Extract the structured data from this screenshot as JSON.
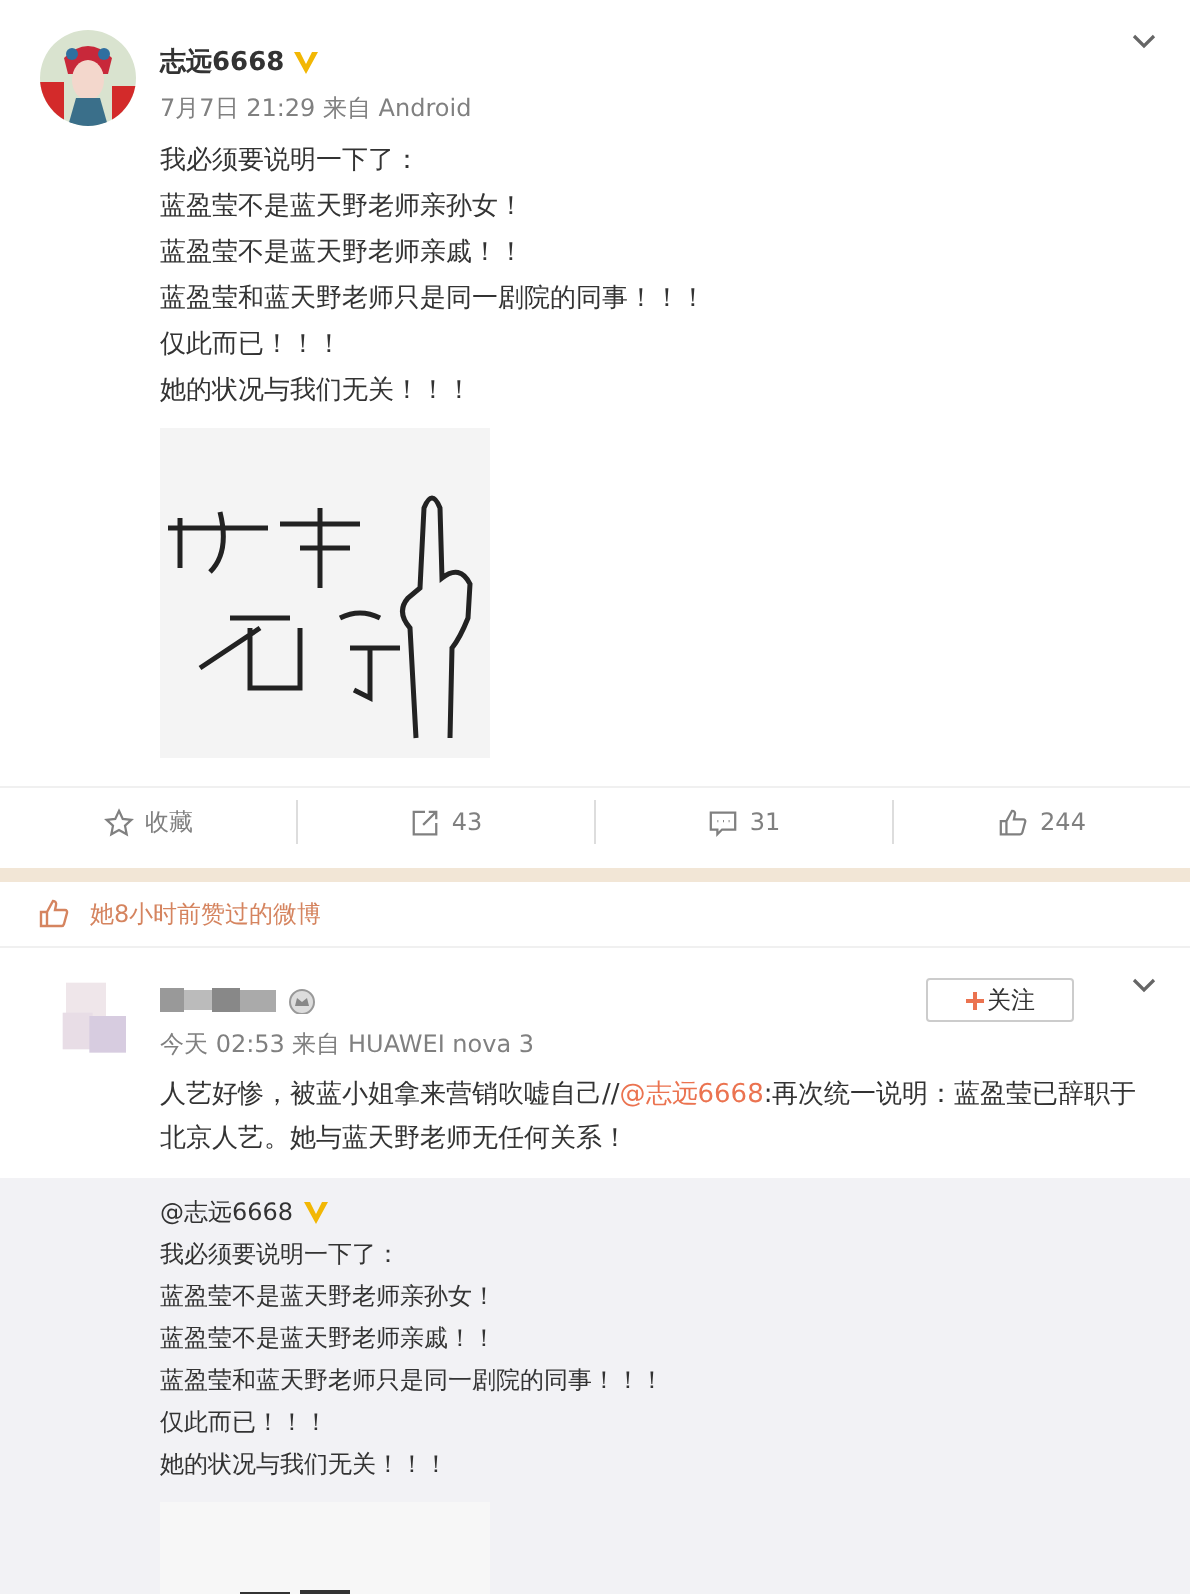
{
  "post": {
    "author": "志远6668",
    "verified": true,
    "meta": "7月7日 21:29 来自 Android",
    "lines": [
      "我必须要说明一下了：",
      "蓝盈莹不是蓝天野老师亲孙女！",
      "蓝盈莹不是蓝天野老师亲戚！！",
      "蓝盈莹和蓝天野老师只是同一剧院的同事！！！",
      "仅此而已！！！",
      "她的状况与我们无关！！！"
    ],
    "actions": [
      {
        "kind": "favorite",
        "label": "收藏"
      },
      {
        "kind": "repost",
        "label": "43"
      },
      {
        "kind": "comment",
        "label": "31"
      },
      {
        "kind": "like",
        "label": "244"
      }
    ]
  },
  "liked_notice": "她8小时前赞过的微博",
  "repost": {
    "meta": "今天 02:53 来自 HUAWEI nova 3",
    "follow_label": "关注",
    "text_before": "人艺好惨，被蓝小姐拿来营销吹嘘自己//",
    "mention": "@志远6668",
    "text_after": ":再次统一说明：蓝盈莹已辞职于北京人艺。她与蓝天野老师无任何关系！",
    "original": {
      "author": "@志远6668",
      "verified": true,
      "lines": [
        "我必须要说明一下了：",
        "蓝盈莹不是蓝天野老师亲孙女！",
        "蓝盈莹不是蓝天野老师亲戚！！",
        "蓝盈莹和蓝天野老师只是同一剧院的同事！！！",
        "仅此而已！！！",
        "她的状况与我们无关！！！"
      ]
    }
  }
}
